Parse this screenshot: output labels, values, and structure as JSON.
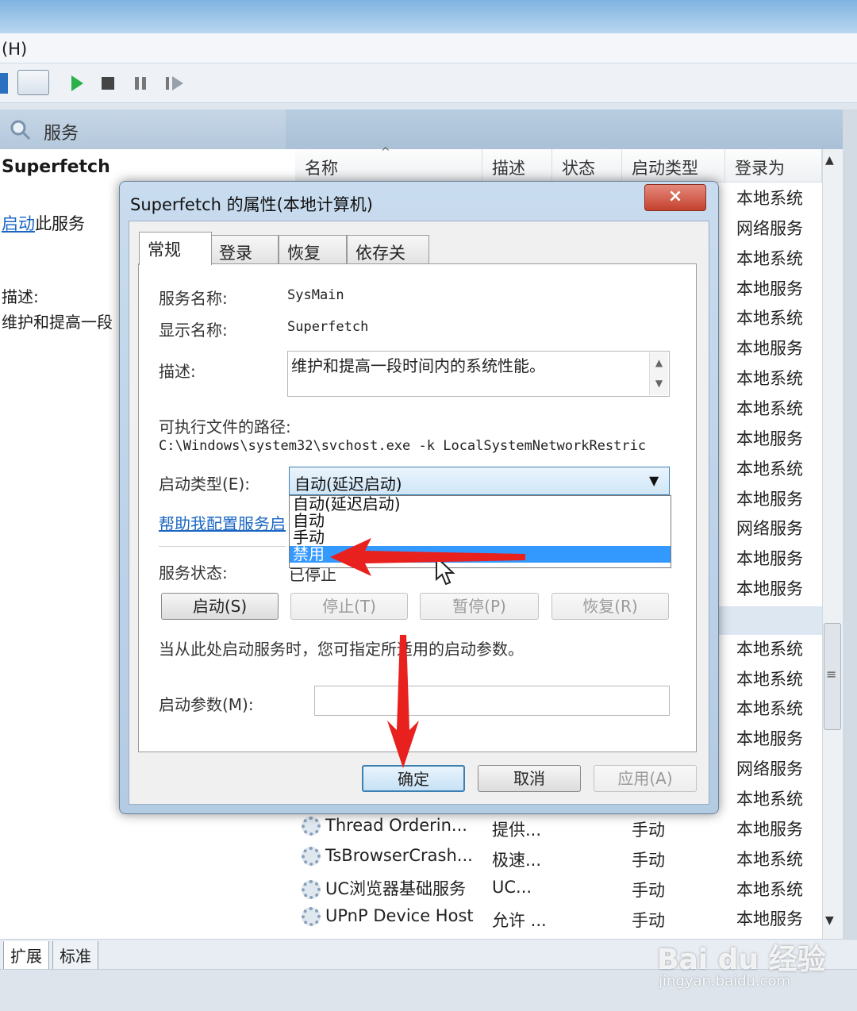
{
  "menubar": {
    "help": "(H)"
  },
  "header": {
    "title": "服务"
  },
  "left_pane": {
    "service_name": "Superfetch",
    "start_link": "启动",
    "start_suffix": "此服务",
    "desc_label": "描述:",
    "desc_text": "维护和提高一段"
  },
  "columns": {
    "name": "名称",
    "desc": "描述",
    "status": "状态",
    "startup": "启动类型",
    "logon": "登录为"
  },
  "logon_column": [
    "本地系统",
    "网络服务",
    "本地系统",
    "本地服务",
    "本地系统",
    "本地服务",
    "本地系统",
    "本地系统",
    "本地服务",
    "本地系统",
    "本地服务",
    "网络服务",
    "本地服务",
    "本地服务",
    "本地系统",
    "本地系统",
    "本地系统",
    "本地系统",
    "本地服务",
    "网络服务",
    "本地系统",
    "本地服务",
    "本地系统",
    "本地系统",
    "本地服务"
  ],
  "visible_rows": [
    {
      "name": "Thread Orderin...",
      "desc": "提供...",
      "startup": "手动"
    },
    {
      "name": "TsBrowserCrash...",
      "desc": "极速...",
      "startup": "手动"
    },
    {
      "name": "UC浏览器基础服务",
      "desc": "UC...",
      "startup": "手动"
    },
    {
      "name": "UPnP Device Host",
      "desc": "允许 ...",
      "startup": "手动"
    }
  ],
  "bottom_tabs": {
    "extended": "扩展",
    "standard": "标准"
  },
  "dialog": {
    "title": "Superfetch 的属性(本地计算机)",
    "close": "×",
    "tabs": [
      "常规",
      "登录",
      "恢复",
      "依存关系"
    ],
    "service_name_label": "服务名称:",
    "service_name_value": "SysMain",
    "display_name_label": "显示名称:",
    "display_name_value": "Superfetch",
    "description_label": "描述:",
    "description_value": "维护和提高一段时间内的系统性能。",
    "path_label": "可执行文件的路径:",
    "path_value": "C:\\Windows\\system32\\svchost.exe -k LocalSystemNetworkRestric",
    "startup_type_label": "启动类型(E):",
    "startup_type_value": "自动(延迟启动)",
    "startup_options": [
      "自动(延迟启动)",
      "自动",
      "手动",
      "禁用"
    ],
    "help_link": "帮助我配置服务启",
    "status_label": "服务状态:",
    "status_value": "已停止",
    "buttons": {
      "start": "启动(S)",
      "stop": "停止(T)",
      "pause": "暂停(P)",
      "resume": "恢复(R)"
    },
    "hint": "当从此处启动服务时，您可指定所适用的启动参数。",
    "params_label": "启动参数(M):",
    "ok": "确定",
    "cancel": "取消",
    "apply": "应用(A)"
  },
  "watermark": {
    "brand": "Bai du 经验",
    "url": "jingyan.baidu.com"
  },
  "colors": {
    "accent": "#3399ff",
    "arrow": "#e8201e",
    "link": "#1a66c2"
  }
}
